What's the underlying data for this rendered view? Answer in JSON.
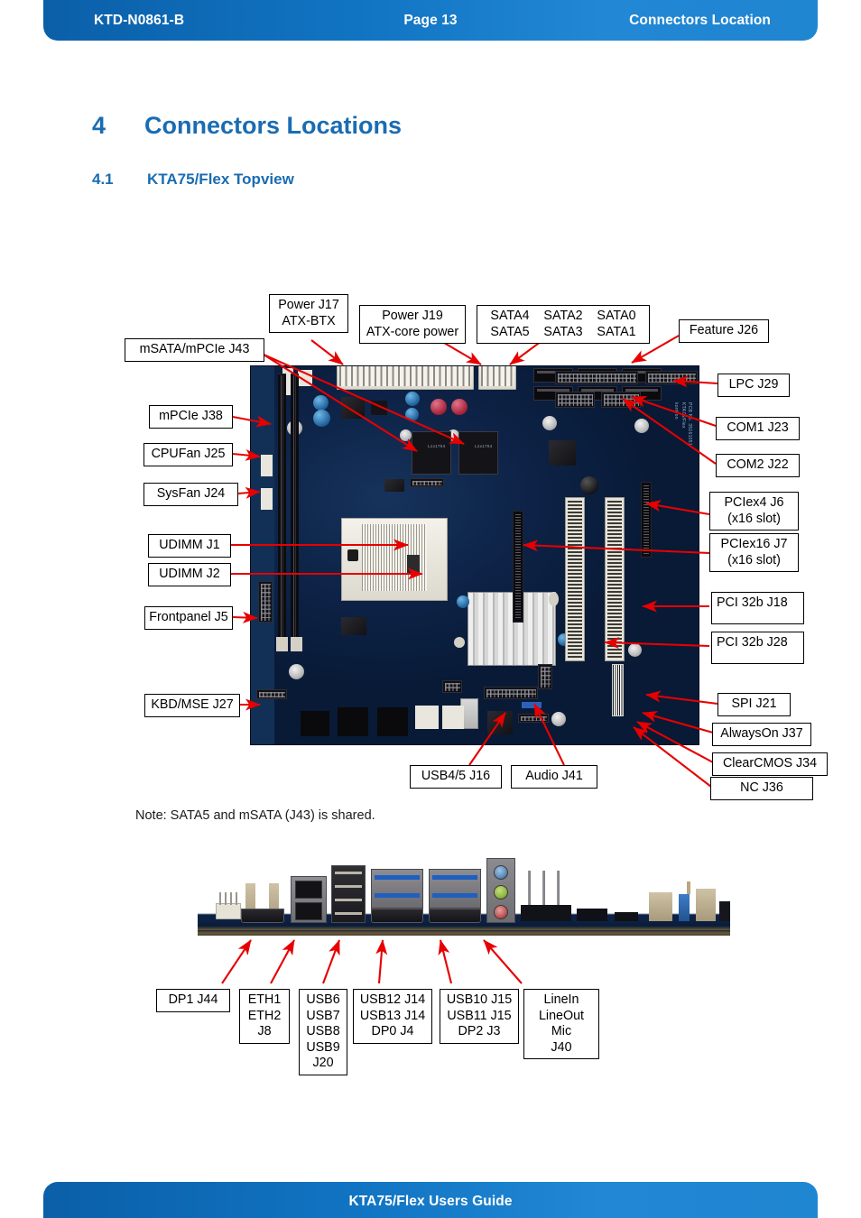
{
  "header": {
    "doc_id": "KTD-N0861-B",
    "page": "Page 13",
    "section": "Connectors Location"
  },
  "footer": {
    "title": "KTA75/Flex Users Guide"
  },
  "headings": {
    "chapter_number": "4",
    "chapter_title": "Connectors Locations",
    "section_number": "4.1",
    "section_title": "KTA75/Flex Topview"
  },
  "note": "Note: SATA5 and mSATA (J43) is shared.",
  "topview_labels": {
    "power_j17": {
      "line1": "Power J17",
      "line2": "ATX-BTX"
    },
    "power_j19": {
      "line1": "Power J19",
      "line2": "ATX-core power"
    },
    "sata_block": {
      "row1": [
        "SATA4",
        "SATA2",
        "SATA0"
      ],
      "row2": [
        "SATA5",
        "SATA3",
        "SATA1"
      ]
    },
    "feature_j26": "Feature J26",
    "msata_j43": "mSATA/mPCIe J43",
    "mpcie_j38": "mPCIe J38",
    "cpufan_j25": "CPUFan J25",
    "sysfan_j24": "SysFan J24",
    "udimm_j1": "UDIMM J1",
    "udimm_j2": "UDIMM J2",
    "frontpanel_j5": "Frontpanel J5",
    "kbd_mse_j27": "KBD/MSE J27",
    "lpc_j29": "LPC J29",
    "com1_j23": "COM1 J23",
    "com2_j22": "COM2 J22",
    "pciex4_j6": {
      "line1": "PCIex4 J6",
      "line2": "(x16 slot)"
    },
    "pciex16_j7": {
      "line1": "PCIex16 J7",
      "line2": "(x16 slot)"
    },
    "pci32b_j18": "PCI 32b J18",
    "pci32b_j28": "PCI 32b J28",
    "spi_j21": "SPI J21",
    "alwayson_j37": "AlwaysOn J37",
    "clearcmos_j34": "ClearCMOS J34",
    "nc_j36": "NC J36",
    "usb45_j16": "USB4/5 J16",
    "audio_j41": "Audio J41"
  },
  "rearview_labels": {
    "dp1_j44": {
      "lines": [
        "DP1 J44"
      ]
    },
    "eth_j8": {
      "lines": [
        "ETH1",
        "ETH2",
        "J8"
      ]
    },
    "usb_j20": {
      "lines": [
        "USB6",
        "USB7",
        "USB8",
        "USB9",
        "J20"
      ]
    },
    "usb12_j14": {
      "lines": [
        "USB12 J14",
        "USB13 J14",
        "DP0 J4"
      ]
    },
    "usb10_j15": {
      "lines": [
        "USB10 J15",
        "USB11 J15",
        "DP2 J3"
      ]
    },
    "audio_j40": {
      "lines": [
        "LineIn",
        "LineOut",
        "Mic",
        "J40"
      ]
    }
  },
  "board_silkscreen": {
    "vendor": "kontron",
    "model": "KTA75/Flex",
    "pcb_no": "PCB No. 35161051"
  },
  "colors": {
    "brand_blue": "#1a6cb2",
    "bar_blue_dark": "#0b5fa8",
    "bar_blue_light": "#2287d4",
    "arrow_red": "#e60000",
    "label_border": "#000000",
    "pcb_navy": "#0a1e3c"
  }
}
